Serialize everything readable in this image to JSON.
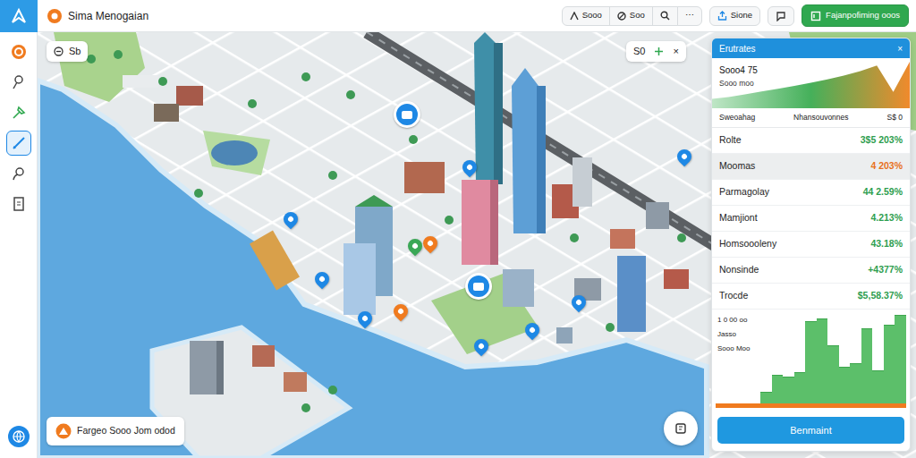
{
  "app": {
    "title": "Sima Menogaian"
  },
  "sidebar": {
    "items": [
      {
        "selected": false
      },
      {
        "selected": false
      },
      {
        "selected": false
      },
      {
        "selected": true
      },
      {
        "selected": false
      },
      {
        "selected": false
      }
    ]
  },
  "toolbar": {
    "group": [
      "Sooo",
      "Soo"
    ],
    "more": "⋯",
    "share": "Sione",
    "primary": "Fajanpofiming ooos"
  },
  "map": {
    "search": "Sb",
    "zoom": "S0",
    "close": "×",
    "legend": "Fargeo Sooo Jom odod",
    "pins": [
      {
        "kind": "large",
        "color": "#1e88e5"
      },
      {
        "kind": "small",
        "color": "#1e88e5"
      },
      {
        "kind": "small",
        "color": "#1e88e5"
      },
      {
        "kind": "small",
        "color": "#3aa856"
      },
      {
        "kind": "small",
        "color": "#f07b1f"
      },
      {
        "kind": "large",
        "color": "#1e88e5"
      },
      {
        "kind": "small",
        "color": "#1e88e5"
      },
      {
        "kind": "small",
        "color": "#f07b1f"
      },
      {
        "kind": "small",
        "color": "#1e88e5"
      },
      {
        "kind": "small",
        "color": "#1e88e5"
      },
      {
        "kind": "small",
        "color": "#1e88e5"
      },
      {
        "kind": "small",
        "color": "#1e88e5"
      },
      {
        "kind": "small",
        "color": "#1e88e5"
      }
    ]
  },
  "panel": {
    "title": "Erutrates",
    "close": "×",
    "summary": {
      "value": "Sooo4 75",
      "caption": "Sooo moo",
      "series": [
        20,
        24,
        30,
        36,
        42,
        48,
        55,
        62,
        70,
        80,
        92,
        35,
        100
      ]
    },
    "columns": [
      "Sweoahag",
      "Nhansouvonnes",
      "S$ 0"
    ],
    "rows": [
      {
        "label": "Rolte",
        "value": "3$5 203%",
        "color": "#2e9e4f",
        "selected": false
      },
      {
        "label": "Moomas",
        "value": "4 203%",
        "color": "#e8711c",
        "selected": true
      },
      {
        "label": "Parmagolay",
        "value": "44 2.59%",
        "color": "#2e9e4f",
        "selected": false
      },
      {
        "label": "Mamjiont",
        "value": "4.213%",
        "color": "#2e9e4f",
        "selected": false
      },
      {
        "label": "Homsoooleny",
        "value": "43.18%",
        "color": "#2e9e4f",
        "selected": false
      },
      {
        "label": "Nonsinde",
        "value": "+4377%",
        "color": "#2e9e4f",
        "selected": false
      },
      {
        "label": "Trocde",
        "value": "$5,58.37%",
        "color": "#2e9e4f",
        "selected": false
      }
    ],
    "chart": {
      "labels": [
        "1 0 00 oo",
        "Jasso",
        "Sooo Moo"
      ],
      "values": [
        12,
        30,
        28,
        32,
        85,
        88,
        60,
        38,
        42,
        78,
        34,
        82,
        92
      ]
    },
    "button": "Benmaint"
  }
}
